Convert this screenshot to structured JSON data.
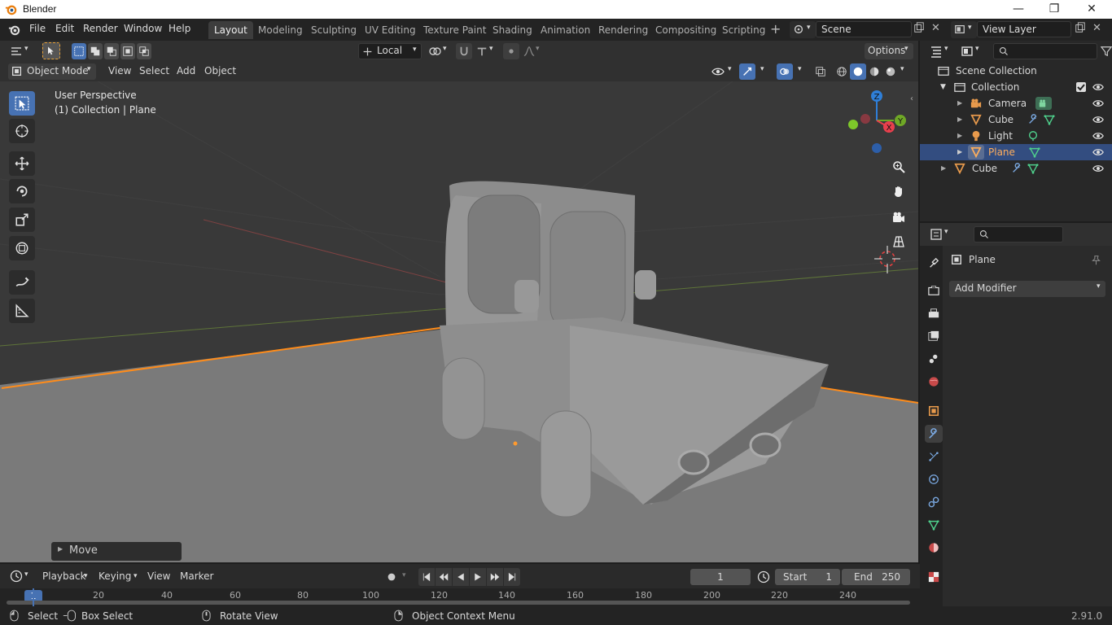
{
  "window": {
    "title": "Blender",
    "controls": [
      "—",
      "❐",
      "✕"
    ]
  },
  "menus": [
    "File",
    "Edit",
    "Render",
    "Window",
    "Help"
  ],
  "workspaces": [
    "Layout",
    "Modeling",
    "Sculpting",
    "UV Editing",
    "Texture Paint",
    "Shading",
    "Animation",
    "Rendering",
    "Compositing",
    "Scripting"
  ],
  "active_workspace": "Layout",
  "scene": {
    "name": "Scene",
    "view_layer": "View Layer"
  },
  "tool_header": {
    "transform_orientation": "Local",
    "options_label": "Options"
  },
  "view_header": {
    "mode": "Object Mode",
    "menus": [
      "View",
      "Select",
      "Add",
      "Object"
    ]
  },
  "viewport": {
    "perspective_label": "User Perspective",
    "collection_label": "(1) Collection | Plane",
    "last_operator": "Move",
    "gizmo_axes": {
      "z": "Z",
      "y": "Y",
      "x": "X"
    }
  },
  "outliner": {
    "root": "Scene Collection",
    "items": [
      {
        "label": "Collection",
        "indent": 1
      },
      {
        "label": "Camera",
        "indent": 2
      },
      {
        "label": "Cube",
        "indent": 2
      },
      {
        "label": "Light",
        "indent": 2
      },
      {
        "label": "Plane",
        "indent": 2,
        "selected": true
      },
      {
        "label": "Cube",
        "indent": 1
      }
    ]
  },
  "properties": {
    "object_name": "Plane",
    "add_modifier_label": "Add Modifier"
  },
  "timeline": {
    "menus": [
      "Playback",
      "Keying",
      "View",
      "Marker"
    ],
    "current_frame": "1",
    "start_label": "Start",
    "start_value": "1",
    "end_label": "End",
    "end_value": "250",
    "ruler": [
      "1",
      "20",
      "40",
      "60",
      "80",
      "100",
      "120",
      "140",
      "160",
      "180",
      "200",
      "220",
      "240"
    ]
  },
  "statusbar": {
    "select": "Select",
    "box_select": "Box Select",
    "rotate_view": "Rotate View",
    "context_menu": "Object Context Menu",
    "version": "2.91.0"
  },
  "colors": {
    "accent": "#4772b3",
    "selection_orange": "#ff8c1a",
    "outliner_selected": "#334d80",
    "x_axis": "#e8404d",
    "y_axis": "#6fa826",
    "z_axis": "#2f7fd8"
  }
}
